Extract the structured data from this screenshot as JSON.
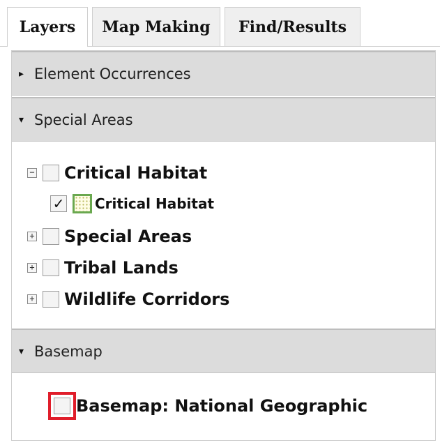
{
  "tabs": [
    {
      "label": "Layers",
      "active": true
    },
    {
      "label": "Map Making",
      "active": false
    },
    {
      "label": "Find/Results",
      "active": false
    }
  ],
  "sections": {
    "element_occurrences": {
      "label": "Element Occurrences",
      "expanded": false
    },
    "special_areas": {
      "label": "Special Areas",
      "expanded": true
    },
    "basemap": {
      "label": "Basemap",
      "expanded": true
    }
  },
  "layers": {
    "critical_habitat_group": {
      "label": "Critical Habitat",
      "expander": "−",
      "checked": false
    },
    "critical_habitat_layer": {
      "label": "Critical Habitat",
      "checked": true,
      "check_mark": "✓",
      "swatch_color": "#6aa84f"
    },
    "special_areas": {
      "label": "Special Areas",
      "expander": "+",
      "checked": false
    },
    "tribal_lands": {
      "label": "Tribal Lands",
      "expander": "+",
      "checked": false
    },
    "wildlife_corridors": {
      "label": "Wildlife Corridors",
      "expander": "+",
      "checked": false
    }
  },
  "basemap_option": {
    "label": "Basemap: National Geographic",
    "checked": false,
    "highlight_color": "#e01e2b"
  },
  "icons": {
    "collapsed_arrow": "▸",
    "expanded_arrow": "▾"
  }
}
